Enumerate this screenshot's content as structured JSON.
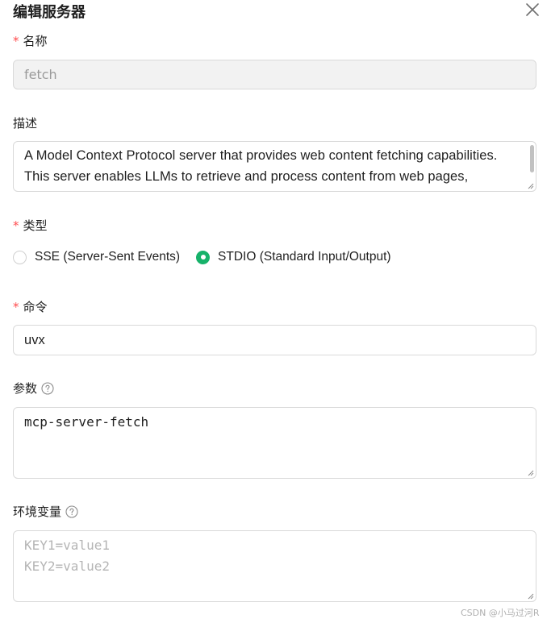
{
  "dialog": {
    "title": "编辑服务器"
  },
  "form": {
    "name": {
      "label": "名称",
      "required_mark": "*",
      "value": "fetch",
      "disabled": true
    },
    "description": {
      "label": "描述",
      "line1": "A Model Context Protocol server that provides web content fetching capabilities.",
      "line2": "This server enables LLMs to retrieve and process content from web pages,"
    },
    "type": {
      "label": "类型",
      "required_mark": "*",
      "options": [
        {
          "label": "SSE (Server-Sent Events)",
          "checked": false
        },
        {
          "label": "STDIO (Standard Input/Output)",
          "checked": true
        }
      ]
    },
    "command": {
      "label": "命令",
      "required_mark": "*",
      "value": "uvx"
    },
    "args": {
      "label": "参数",
      "value": "mcp-server-fetch"
    },
    "env": {
      "label": "环境变量",
      "placeholder_line1": "KEY1=value1",
      "placeholder_line2": "KEY2=value2"
    }
  },
  "watermark": "CSDN @小马过河R",
  "colors": {
    "required": "#ff4d4f",
    "radio_checked": "#17b26a",
    "border": "#d9d9d9",
    "disabled_bg": "#f2f2f2"
  },
  "icons": {
    "close": "close-icon",
    "help": "question-circle-icon"
  }
}
